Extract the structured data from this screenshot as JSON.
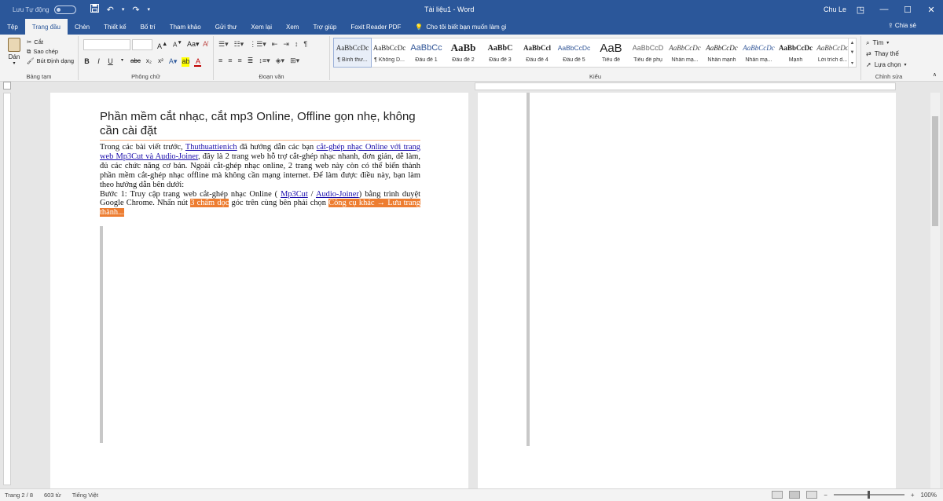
{
  "titlebar": {
    "autosave_label": "Lưu Tự động",
    "doc_title": "Tài liệu1  -  Word",
    "user": "Chu Le",
    "save_icon": "save-icon",
    "undo_icon": "undo-icon",
    "redo_icon": "redo-icon"
  },
  "tabs": [
    "Tệp",
    "Trang đầu",
    "Chèn",
    "Thiết kế",
    "Bố trí",
    "Tham khảo",
    "Gửi thư",
    "Xem lại",
    "Xem",
    "Trợ giúp",
    "Foxit Reader PDF"
  ],
  "tellme": "Cho tôi biết bạn muốn làm gì",
  "share": "Chia sẻ",
  "ribbon": {
    "clipboard": {
      "paste": "Dán",
      "cut": "Cắt",
      "copy": "Sao chép",
      "format_painter": "Bút Định dạng",
      "label": "Bảng tạm"
    },
    "font": {
      "label": "Phông chữ"
    },
    "paragraph": {
      "label": "Đoạn văn"
    },
    "styles": {
      "label": "Kiểu",
      "items": [
        {
          "sample": "AaBbCcDc",
          "name": "¶ Bình thư..."
        },
        {
          "sample": "AaBbCcDc",
          "name": "¶ Không D..."
        },
        {
          "sample": "AaBbCc",
          "name": "Đầu đề 1"
        },
        {
          "sample": "AaBb",
          "name": "Đầu đề 2"
        },
        {
          "sample": "AaBbC",
          "name": "Đầu đề 3"
        },
        {
          "sample": "AaBbCcl",
          "name": "Đầu đề 4"
        },
        {
          "sample": "AaBbCcDc",
          "name": "Đầu đề 5"
        },
        {
          "sample": "AaB",
          "name": "Tiêu đề"
        },
        {
          "sample": "AaBbCcD",
          "name": "Tiêu đề phụ"
        },
        {
          "sample": "AaBbCcDc",
          "name": "Nhấn mạ..."
        },
        {
          "sample": "AaBbCcDc",
          "name": "Nhấn mạnh"
        },
        {
          "sample": "AaBbCcDc",
          "name": "Nhấn mạ..."
        },
        {
          "sample": "AaBbCcDc",
          "name": "Mạnh"
        },
        {
          "sample": "AaBbCcDc",
          "name": "Lời trích d..."
        }
      ]
    },
    "editing": {
      "label": "Chỉnh sửa",
      "find": "Tìm",
      "replace": "Thay thế",
      "select": "Lựa chọn"
    }
  },
  "document": {
    "heading": "Phần mềm cắt nhạc, cắt mp3 Online, Offline gọn nhẹ, không cần cài đặt",
    "p1_a": "Trong các bài viết trước, ",
    "p1_link1": "Thuthuattienich",
    "p1_b": " đã hướng dẫn các bạn ",
    "p1_link2": "cắt-ghép nhạc Online với trang web Mp3Cut và Audio-Joiner",
    "p1_c": ", đây là 2 trang web hỗ trợ cắt-ghép nhạc nhanh, đơn giản, dễ làm, đủ các chức năng cơ bản. Ngoài cắt-ghép nhạc online, 2 trang web này còn có thể biến thành phần mềm cắt-ghép nhạc offline mà không cần mạng internet. Để làm được điều này, bạn làm theo hướng dẫn bên dưới:",
    "p2_a": "Bước 1: Truy cập trang web cắt-ghép nhạc Online ( ",
    "p2_link1": "Mp3Cut",
    "p2_sep": " / ",
    "p2_link2": "Audio-Joiner",
    "p2_b": ") bằng trình duyệt Google Chrome. Nhấn nút ",
    "p2_hl1": "3 chấm dọc",
    "p2_c": " góc trên cùng bên phải chọn ",
    "p2_hl2": "Công cụ khác → Lưu trang thành..."
  },
  "status": {
    "page": "Trang 2 / 8",
    "words": "603 từ",
    "language": "Tiếng Việt",
    "zoom": "100%"
  }
}
